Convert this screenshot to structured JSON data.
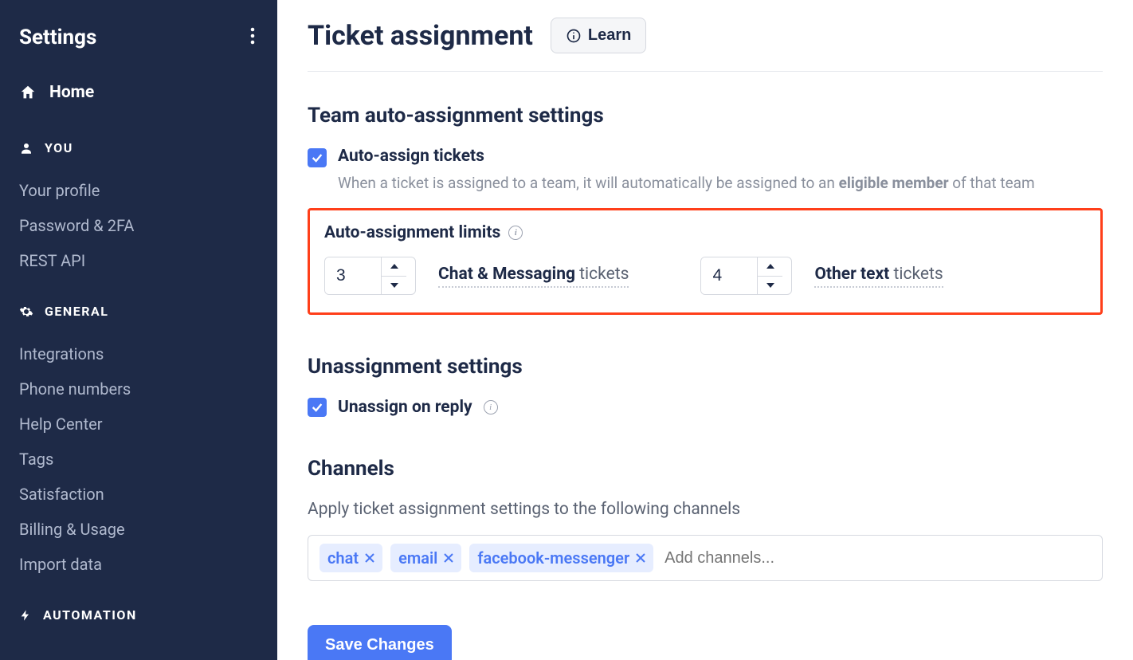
{
  "sidebar": {
    "title": "Settings",
    "home": "Home",
    "groups": {
      "you": {
        "header": "YOU",
        "items": [
          "Your profile",
          "Password & 2FA",
          "REST API"
        ]
      },
      "general": {
        "header": "GENERAL",
        "items": [
          "Integrations",
          "Phone numbers",
          "Help Center",
          "Tags",
          "Satisfaction",
          "Billing & Usage",
          "Import data"
        ]
      },
      "automation": {
        "header": "AUTOMATION"
      }
    }
  },
  "main": {
    "title": "Ticket assignment",
    "learn": "Learn",
    "team_settings": {
      "title": "Team auto-assignment settings",
      "auto_assign_label": "Auto-assign tickets",
      "auto_assign_desc_pre": "When a ticket is assigned to a team, it will automatically be assigned to an ",
      "auto_assign_desc_strong": "eligible member",
      "auto_assign_desc_post": " of that team",
      "limits_label": "Auto-assignment limits",
      "limit1_value": "3",
      "limit1_strong": "Chat & Messaging",
      "limit1_suffix": " tickets",
      "limit2_value": "4",
      "limit2_strong": "Other text",
      "limit2_suffix": " tickets"
    },
    "unassign": {
      "title": "Unassignment settings",
      "label": "Unassign on reply"
    },
    "channels": {
      "title": "Channels",
      "desc": "Apply ticket assignment settings to the following channels",
      "tags": [
        "chat",
        "email",
        "facebook-messenger"
      ],
      "placeholder": "Add channels..."
    },
    "save": "Save Changes"
  }
}
